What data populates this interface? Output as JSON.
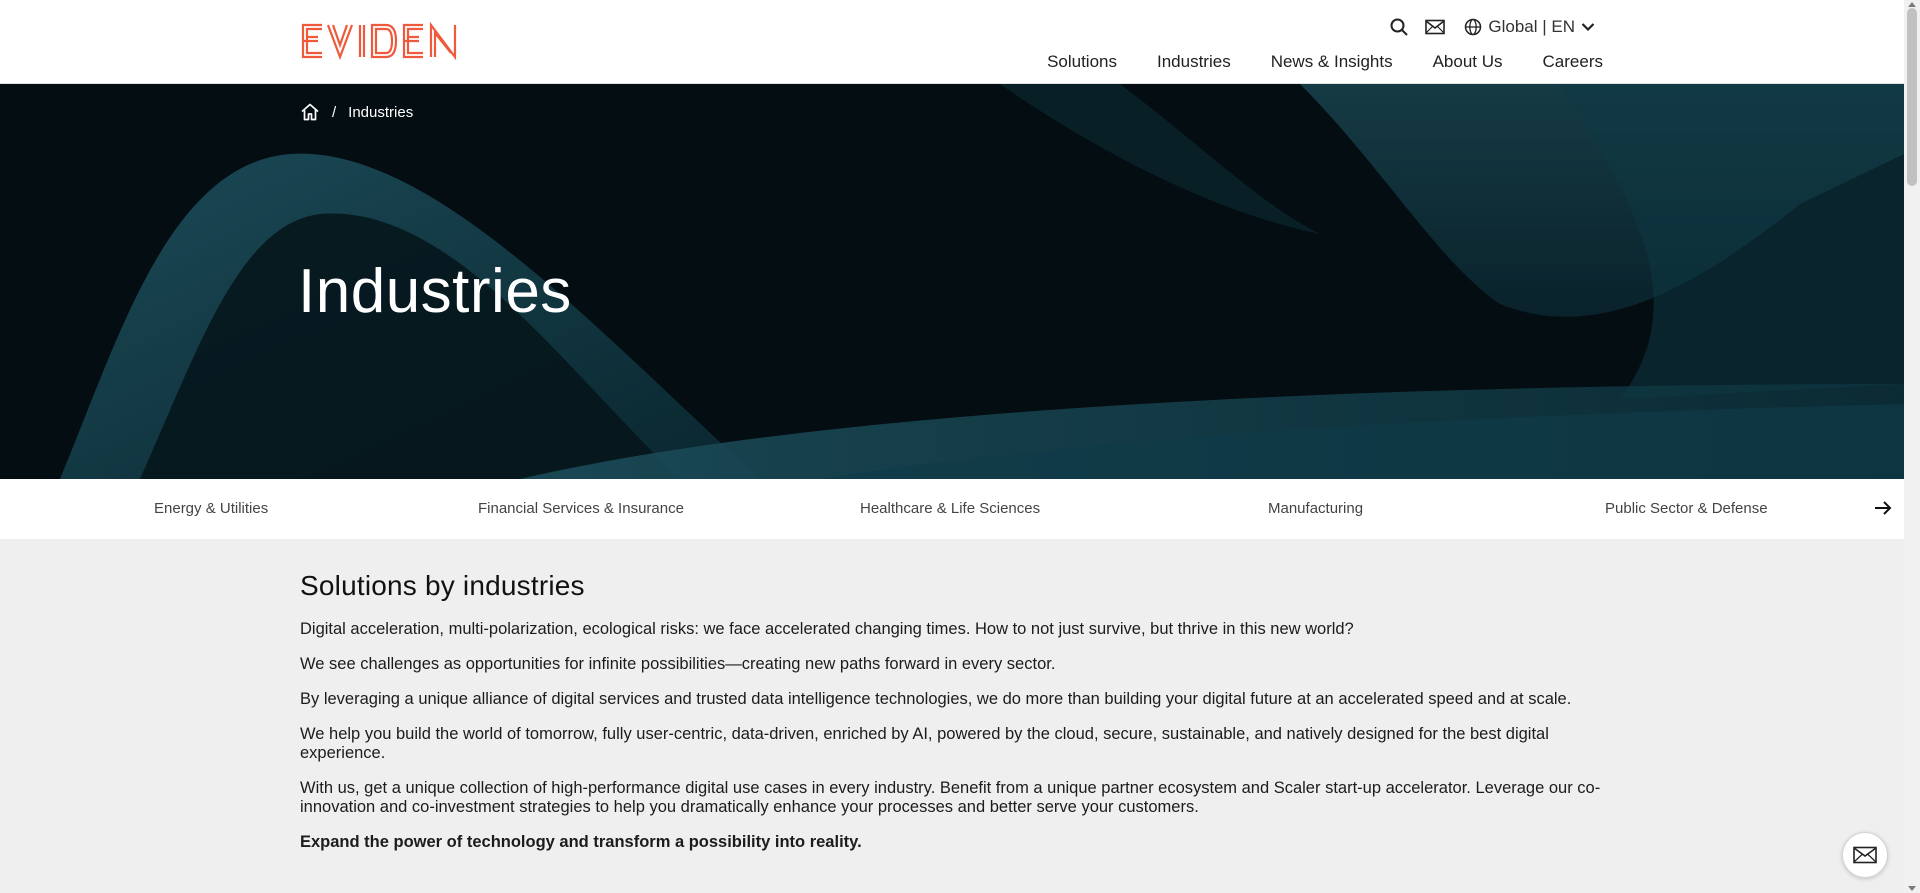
{
  "brand": {
    "logo_text": "EVIDEN",
    "accent": "#f05a3c"
  },
  "header": {
    "utility": {
      "search_icon": "search-icon",
      "mail_icon": "mail-icon",
      "globe_icon": "globe-icon",
      "language": "Global | EN"
    },
    "nav": [
      "Solutions",
      "Industries",
      "News & Insights",
      "About Us",
      "Careers"
    ]
  },
  "breadcrumb": {
    "home_icon": "home-icon",
    "separator": "/",
    "current": "Industries"
  },
  "hero": {
    "title": "Industries"
  },
  "industries": [
    "Energy & Utilities",
    "Financial Services & Insurance",
    "Healthcare & Life Sciences",
    "Manufacturing",
    "Public Sector & Defense"
  ],
  "content": {
    "heading": "Solutions by industries",
    "paragraphs": [
      "Digital acceleration, multi-polarization, ecological risks: we face accelerated changing times. How to not just survive, but thrive in this new world?",
      "We see challenges as opportunities for infinite possibilities—creating new paths forward in every sector.",
      "By leveraging a unique alliance of digital services and trusted data intelligence technologies, we do more than building your digital future at an accelerated speed and at scale.",
      "We help you build the world of tomorrow, fully user-centric, data-driven, enriched by AI, powered by the cloud, secure, sustainable, and natively designed for the best digital experience.",
      "With us, get a unique collection of high-performance digital use cases in every industry. Benefit from a unique partner ecosystem and Scaler start-up accelerator. Leverage our co-innovation and co-investment strategies to help you dramatically enhance your processes and better serve your customers."
    ],
    "closing": "Expand the power of technology and transform a possibility into reality."
  }
}
